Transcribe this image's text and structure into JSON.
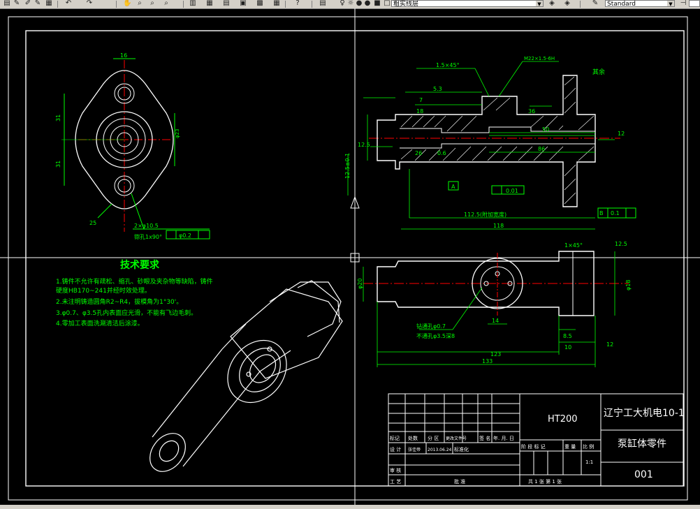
{
  "toolbar": {
    "layer_name": "粗实线层",
    "text_style": "Standard"
  },
  "drawing": {
    "tech_title": "技术要求",
    "tech_notes": [
      "1.铸件不允许有疏松、缩孔、砂眼及夹杂物等缺陷，铸件",
      "硬度HB170~241并经时效处理。",
      "2.未注明铸造圆角R2~R4，拔模角为1°30'。",
      "3.φ0.7、φ3.5孔内表面应光滑，不能有飞边毛刺。",
      "4.零加工表面洗涮清洁后涂漆。"
    ],
    "dims": {
      "d16": "16",
      "d31a": "31",
      "d31b": "31",
      "dia23": "φ23",
      "r25": "25",
      "hole2": "2×φ10.5",
      "spot": "锪孔1x90°",
      "chamfer15": "1.5×45°",
      "thread": "M22-6H",
      "thread2": "M22×1.5-6H",
      "d53": "5.3",
      "d18": "18",
      "d7": "7",
      "d36": "36",
      "d50": "50",
      "d86": "86",
      "d26": "26",
      "d06": "0.6",
      "d112": "112.5(附加宽度)",
      "d118": "118",
      "d125": "12.5",
      "d1125r": "12.5±0.1",
      "tol001": "0.01",
      "tol01": "0.1",
      "tol02": "φ0.2",
      "datum_a": "A",
      "datum_b": "B",
      "rest": "其余",
      "hole_note1": "钻通孔φ0.7",
      "hole_note2": "不通孔φ3.5深8",
      "d123": "123",
      "d133": "133",
      "d145": "1×45°",
      "d14": "14",
      "d10": "10",
      "d85": "8.5",
      "d125b": "12.5",
      "d12": "12",
      "d18b": "φ18",
      "d20": "φ20"
    },
    "title_block": {
      "material": "HT200",
      "school": "辽宁工大机电10-1",
      "part_name": "泵缸体零件",
      "drawing_no": "001",
      "scale": "1:1",
      "row_labels": [
        "标记",
        "处数",
        "分 区",
        "更改文件号",
        "签 名",
        "年. 月. 日"
      ],
      "design_label": "设 计",
      "designer": "张佳帝",
      "date": "2013.06.24",
      "std_label": "标准化",
      "stage_label": "阶 段 标 记",
      "weight_label": "重 量",
      "scale_label": "比 例",
      "review_label": "审 核",
      "process_label": "工 艺",
      "approve_label": "批 准",
      "sheets": "共 1  张  第  1 张"
    }
  }
}
